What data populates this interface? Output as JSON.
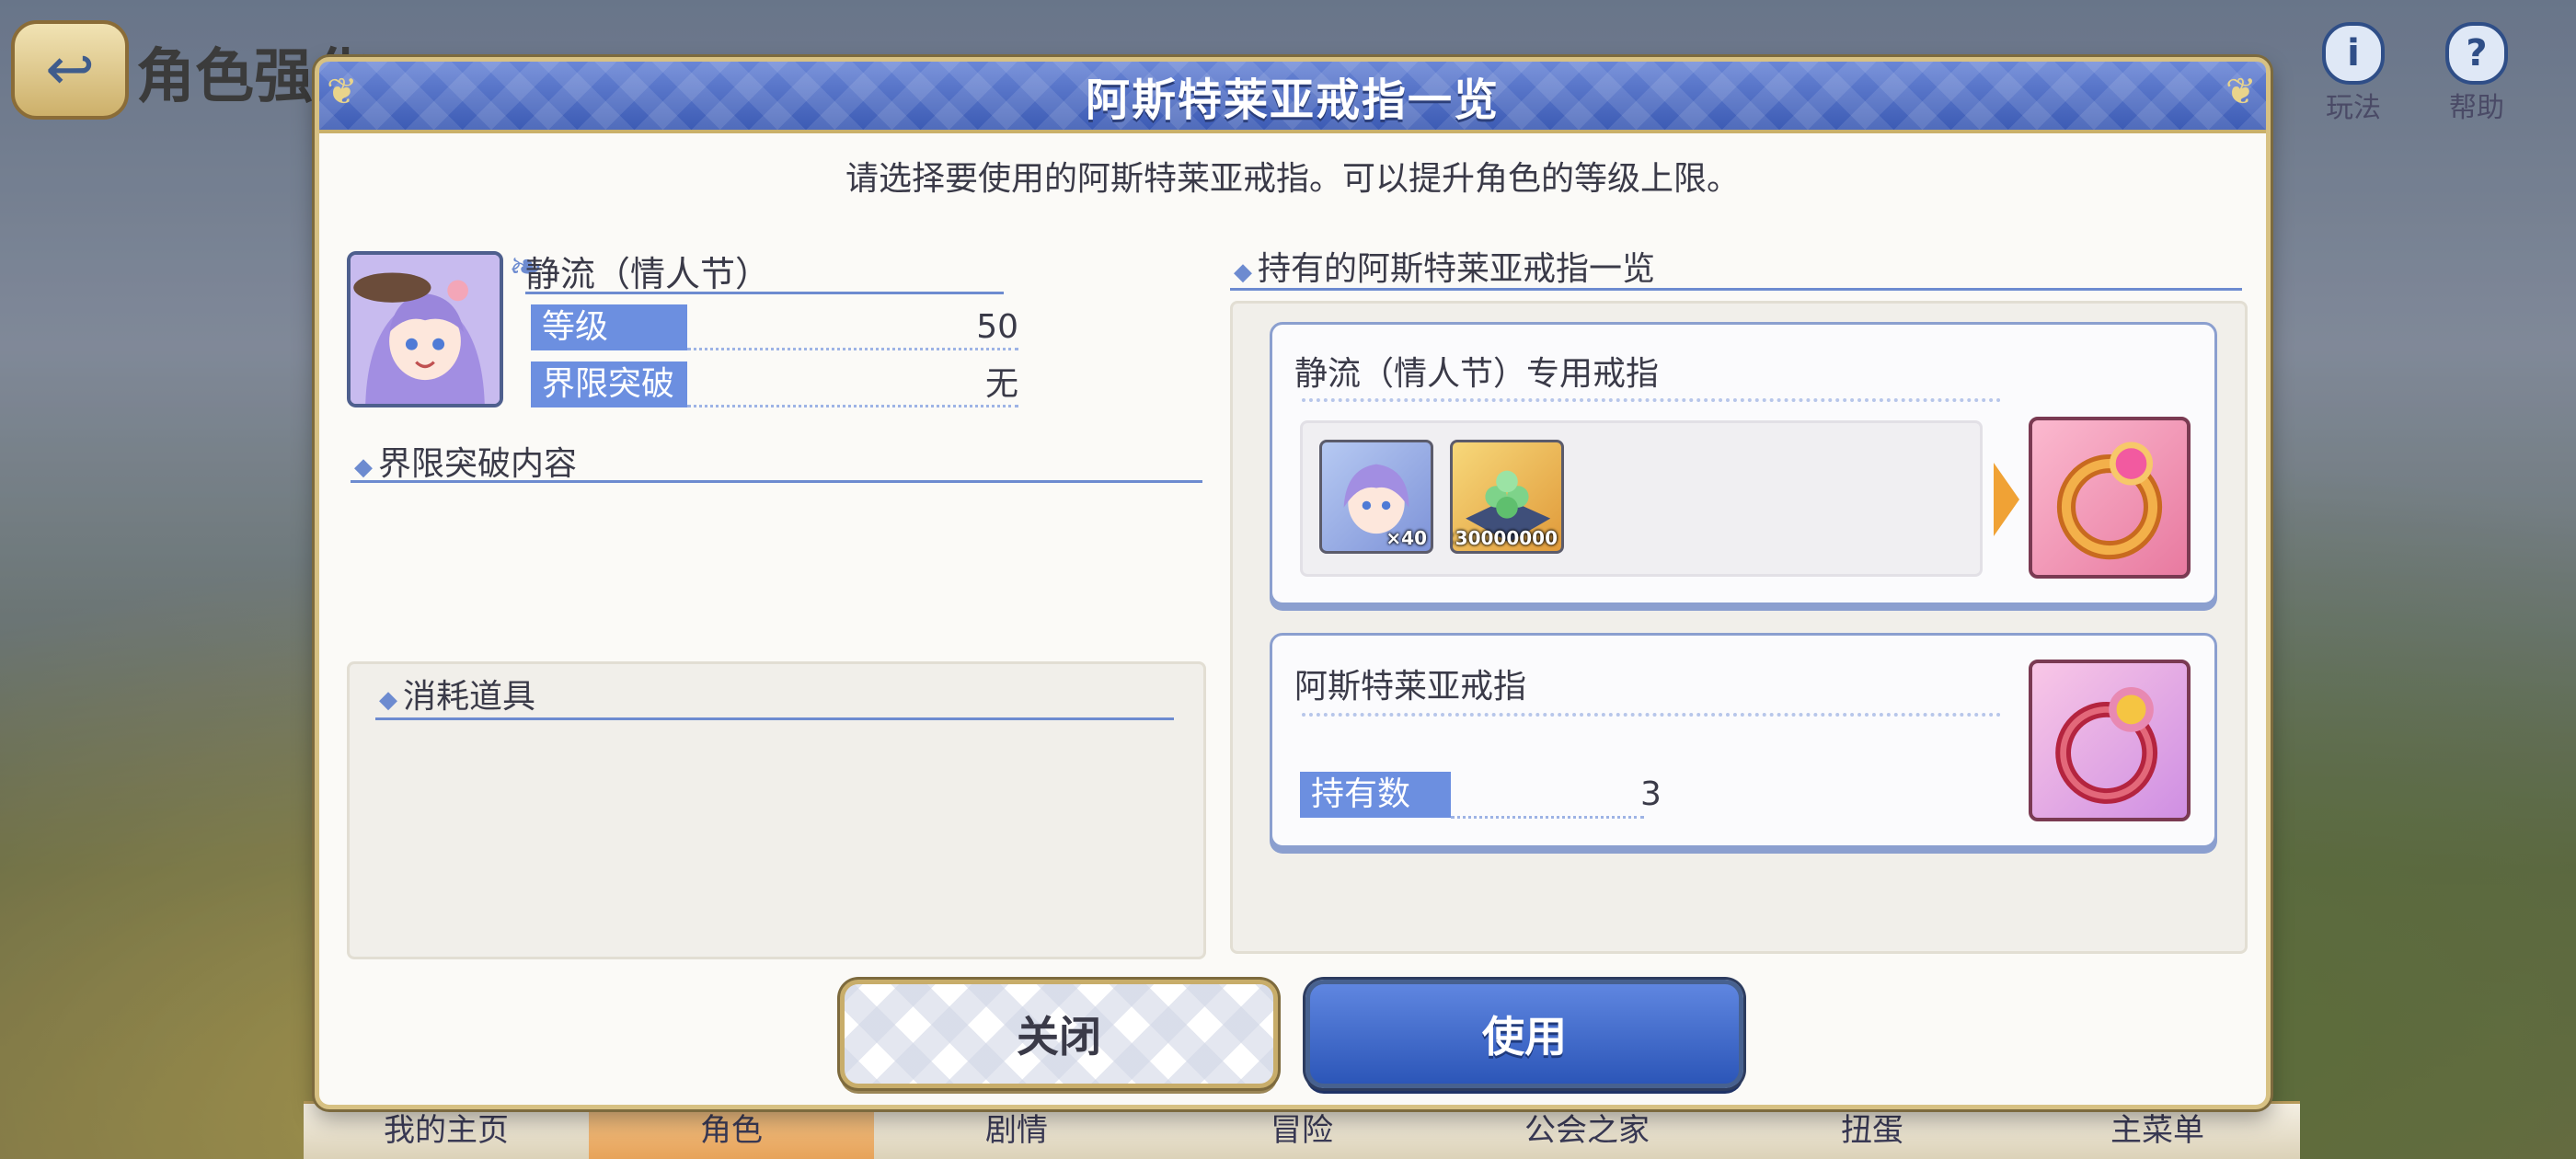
{
  "screen": {
    "title": "角色强化",
    "back_label": "↩",
    "top_right": [
      {
        "icon": "info-icon",
        "glyph": "i",
        "label": "玩法"
      },
      {
        "icon": "help-icon",
        "glyph": "?",
        "label": "帮助"
      }
    ],
    "bottom_nav": [
      "我的主页",
      "角色",
      "剧情",
      "冒险",
      "公会之家",
      "扭蛋",
      "主菜单"
    ]
  },
  "modal": {
    "title": "阿斯特莱亚戒指一览",
    "instruction": "请选择要使用的阿斯特莱亚戒指。可以提升角色的等级上限。",
    "character": {
      "name": "静流（情人节）",
      "level_label": "等级",
      "level_value": "50",
      "limit_label": "界限突破",
      "limit_value": "无"
    },
    "limit_break_section": "界限突破内容",
    "consumables_section": "消耗道具",
    "owned_section": "持有的阿斯特莱亚戒指一览",
    "exclusive_ring": {
      "title": "静流（情人节）专用戒指",
      "materials": [
        {
          "icon": "character-memory-piece-icon",
          "qty": "×40"
        },
        {
          "icon": "mana-coins-icon",
          "qty": "×30000000"
        }
      ],
      "result_icon": "exclusive-ring-icon"
    },
    "generic_ring": {
      "title": "阿斯特莱亚戒指",
      "hold_label": "持有数",
      "hold_value": "3",
      "icon": "astraea-ring-icon"
    },
    "buttons": {
      "close": "关闭",
      "use": "使用"
    }
  },
  "colors": {
    "header_blue": "#3c5bb4",
    "label_blue": "#6c8fe0",
    "gold_border": "#d7c183",
    "accent_orange": "#f0a235"
  }
}
